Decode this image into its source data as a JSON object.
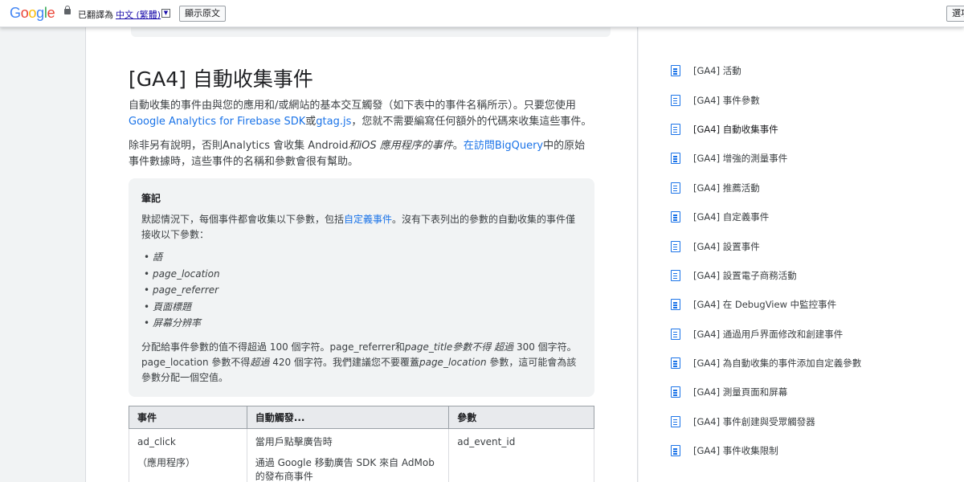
{
  "translate_bar": {
    "logo": [
      "G",
      "o",
      "o",
      "g",
      "l",
      "e"
    ],
    "message": "已翻譯為",
    "language": "中文 (繁體)",
    "caret": "▼",
    "show_original": "顯示原文",
    "right_button": "選項"
  },
  "article": {
    "title": "[GA4] 自動收集事件",
    "p1_a": "自動收集的事件由與您的應用和/或網站的基本交互觸發（如下表中的事件名稱所示）。只要您使用",
    "p1_link1": "Google Analytics for Firebase SDK",
    "p1_b": "或",
    "p1_link2": "gtag.js",
    "p1_c": "，您就不需要編寫任何額外的代碼來收集這些事件。",
    "p2_a": "除非另有說明，否則Analytics 會收集 Android",
    "p2_i": "和iOS 應用程序的事件",
    "p2_b": "。",
    "p2_link": "在訪問BigQuery",
    "p2_c": "中的原始事件數據時，這些事件的名稱和參數會很有幫助。"
  },
  "note": {
    "title": "筆記",
    "text_a": "默認情況下，每個事件都會收集以下參數，包括",
    "text_link": "自定義事件",
    "text_b": "。沒有下表列出的參數的自動收集的事件僅接收以下參數：",
    "items": [
      "語",
      "page_location",
      "page_referrer",
      "頁面標題",
      "屏幕分辨率"
    ],
    "footer_a": "分配給事件參數的值不得超過 100 個字符。page_referrer和",
    "footer_i1": "page_title參數不得 超過",
    "footer_b": " 300 個字符。page_location 參數不得",
    "footer_i2": "超過",
    "footer_c": " 420 個字符。我們建議您不要覆蓋",
    "footer_i3": "page_location",
    "footer_d": " 參數，這可能會為該參數分配一個空值。"
  },
  "table": {
    "headers": [
      "事件",
      "自動觸發...",
      "參數"
    ],
    "row1": {
      "event": "ad_click",
      "event_sub": "（應用程序）",
      "trigger": "當用戶點擊廣告時",
      "trigger_sub": "通過 Google 移動廣告 SDK 來自 AdMob 的發布商事件",
      "param": "ad_event_id"
    }
  },
  "toc": {
    "items": [
      "[GA4] 活動",
      "[GA4] 事件參數",
      "[GA4] 自動收集事件",
      "[GA4] 增強的測量事件",
      "[GA4] 推薦活動",
      "[GA4] 自定義事件",
      "[GA4] 設置事件",
      "[GA4] 設置電子商務活動",
      "[GA4] 在 DebugView 中監控事件",
      "[GA4] 通過用戶界面修改和創建事件",
      "[GA4] 為自動收集的事件添加自定義參數",
      "[GA4] 測量頁面和屏幕",
      "[GA4] 事件創建與受眾觸發器",
      "[GA4] 事件收集限制"
    ],
    "active_index": 2
  },
  "colors": {
    "link": "#1a73e8",
    "icon": "#1a73e8",
    "note_bg": "#f1f3f4"
  }
}
